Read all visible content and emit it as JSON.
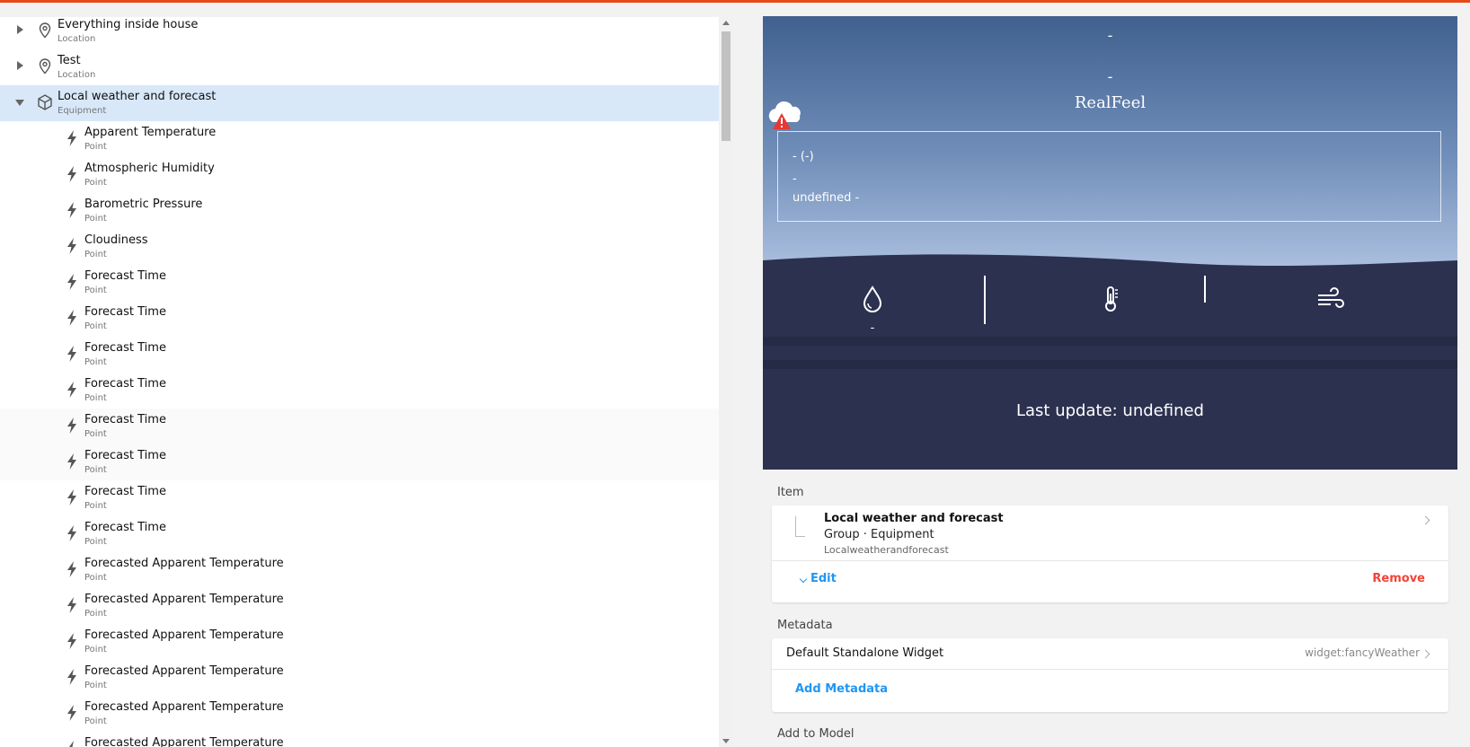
{
  "tree": {
    "rows": [
      {
        "label": "Everything inside house",
        "sub": "Location",
        "kind": "location",
        "expander": "collapsed"
      },
      {
        "label": "Test",
        "sub": "Location",
        "kind": "location",
        "expander": "collapsed"
      },
      {
        "label": "Local weather and forecast",
        "sub": "Equipment",
        "kind": "equipment",
        "expander": "expanded",
        "selected": true
      },
      {
        "label": "Apparent Temperature",
        "sub": "Point",
        "kind": "point"
      },
      {
        "label": "Atmospheric Humidity",
        "sub": "Point",
        "kind": "point"
      },
      {
        "label": "Barometric Pressure",
        "sub": "Point",
        "kind": "point"
      },
      {
        "label": "Cloudiness",
        "sub": "Point",
        "kind": "point"
      },
      {
        "label": "Forecast Time",
        "sub": "Point",
        "kind": "point"
      },
      {
        "label": "Forecast Time",
        "sub": "Point",
        "kind": "point"
      },
      {
        "label": "Forecast Time",
        "sub": "Point",
        "kind": "point"
      },
      {
        "label": "Forecast Time",
        "sub": "Point",
        "kind": "point"
      },
      {
        "label": "Forecast Time",
        "sub": "Point",
        "kind": "point",
        "hover": true
      },
      {
        "label": "Forecast Time",
        "sub": "Point",
        "kind": "point",
        "hover": true
      },
      {
        "label": "Forecast Time",
        "sub": "Point",
        "kind": "point"
      },
      {
        "label": "Forecast Time",
        "sub": "Point",
        "kind": "point"
      },
      {
        "label": "Forecasted Apparent Temperature",
        "sub": "Point",
        "kind": "point"
      },
      {
        "label": "Forecasted Apparent Temperature",
        "sub": "Point",
        "kind": "point"
      },
      {
        "label": "Forecasted Apparent Temperature",
        "sub": "Point",
        "kind": "point"
      },
      {
        "label": "Forecasted Apparent Temperature",
        "sub": "Point",
        "kind": "point"
      },
      {
        "label": "Forecasted Apparent Temperature",
        "sub": "Point",
        "kind": "point"
      },
      {
        "label": "Forecasted Apparent Temperature",
        "sub": "Point",
        "kind": "point"
      }
    ]
  },
  "weather": {
    "line1": "-",
    "line2": "-",
    "realfeel": "RealFeel",
    "box_main": "-  (-)",
    "box_dash": "-",
    "box_undef": "undefined -",
    "humidity_value": "-",
    "last_update": "Last update: undefined",
    "colors": {
      "sky_top": "#40608f",
      "sky_bottom": "#c6d4ea",
      "ground": "#2c3150"
    }
  },
  "item_section": {
    "label": "Item",
    "title": "Local weather and forecast",
    "type": "Group · Equipment",
    "name": "Localweatherandforecast",
    "edit": "Edit",
    "remove": "Remove"
  },
  "metadata_section": {
    "label": "Metadata",
    "row_label": "Default Standalone Widget",
    "row_value": "widget:fancyWeather",
    "add": "Add Metadata"
  },
  "model_section": {
    "label": "Add to Model"
  },
  "colors": {
    "accent": "#2196f3",
    "danger": "#f44336",
    "topbar": "#e64a19",
    "selected_row": "#d8e8f9"
  }
}
